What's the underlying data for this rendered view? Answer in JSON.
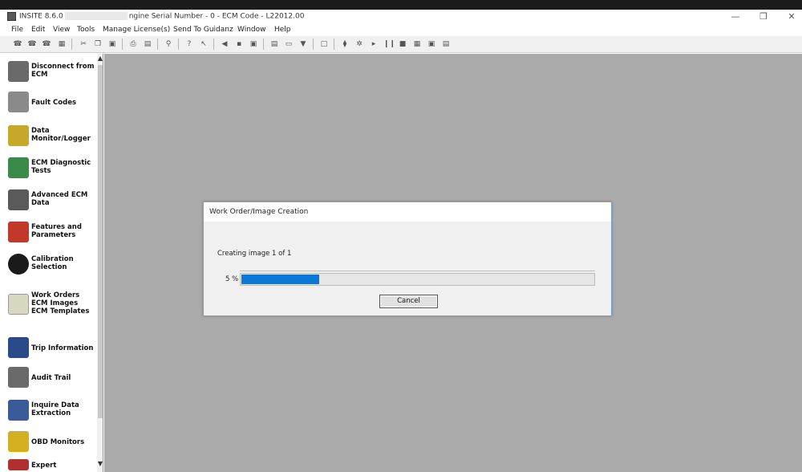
{
  "window": {
    "title_left": "INSITE 8.6.0",
    "title_right": "ngine Serial Number - 0 - ECM Code - L22012.00",
    "minimize": "—",
    "restore": "❐",
    "close": "✕"
  },
  "menu": [
    "File",
    "Edit",
    "View",
    "Tools",
    "Manage License(s)",
    "Send To Guidanz",
    "Window",
    "Help"
  ],
  "sidebar": {
    "items": [
      {
        "label": "Disconnect from ECM",
        "icon": "disconnect-icon",
        "color": "#6a6a6a"
      },
      {
        "label": "Fault Codes",
        "icon": "fault-codes-icon",
        "color": "#8a8a8a"
      },
      {
        "label": "Data Monitor/Logger",
        "icon": "data-monitor-icon",
        "color": "#c8a82a"
      },
      {
        "label": "ECM Diagnostic Tests",
        "icon": "diagnostic-tests-icon",
        "color": "#3a8a4a"
      },
      {
        "label": "Advanced ECM Data",
        "icon": "advanced-data-icon",
        "color": "#5a5a5a"
      },
      {
        "label": "Features and Parameters",
        "icon": "features-icon",
        "color": "#c0392b"
      },
      {
        "label": "Calibration Selection",
        "icon": "calibration-icon",
        "color": "#1a1a1a"
      },
      {
        "label": "Work Orders ECM Images ECM Templates",
        "icon": "work-orders-icon",
        "color": "#d8d8c0"
      },
      {
        "label": "Trip Information",
        "icon": "trip-info-icon",
        "color": "#2a4a8a"
      },
      {
        "label": "Audit Trail",
        "icon": "audit-trail-icon",
        "color": "#6a6a6a"
      },
      {
        "label": "Inquire Data Extraction",
        "icon": "inquire-data-icon",
        "color": "#3a5a9a"
      },
      {
        "label": "OBD Monitors",
        "icon": "obd-monitors-icon",
        "color": "#d4b020"
      },
      {
        "label": "Expert",
        "icon": "expert-icon",
        "color": "#b03030"
      }
    ]
  },
  "dialog": {
    "title": "Work Order/Image Creation",
    "message": "Creating image 1 of 1",
    "percent_label": "5 %",
    "progress": 0.05,
    "cancel_label": "Cancel"
  },
  "colors": {
    "mdi_background": "#aaaaaa",
    "progress_fill": "#0a78d7"
  }
}
